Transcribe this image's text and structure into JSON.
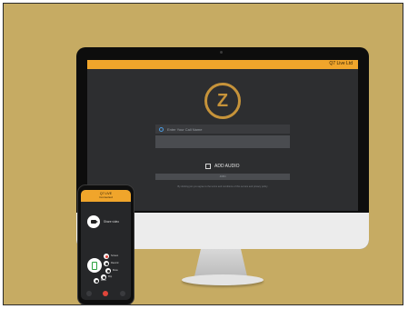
{
  "desktop": {
    "brand": "Q7 Live Ltd",
    "logo_letter": "Z",
    "name_label": "Enter Your Call Name",
    "name_input_placeholder": "",
    "audio_label": "ADD AUDIO",
    "join_label": "JOIN",
    "fine_print": "By clicking join you agree to the terms and conditions of this service and privacy policy"
  },
  "phone": {
    "title": "Q7 LIVE",
    "subtitle": "Connected",
    "camera_label": "Share video",
    "menu": [
      {
        "label": "Screen",
        "color": "#e0453a"
      },
      {
        "label": "Record",
        "color": "#2b2b2b"
      },
      {
        "label": "Mute",
        "color": "#2b2b2b"
      },
      {
        "label": "Flip",
        "color": "#2b2b2b"
      },
      {
        "label": "More",
        "color": "#2b2b2b"
      }
    ],
    "bar": [
      {
        "name": "mic",
        "color": "#3a3b3e"
      },
      {
        "name": "end-call",
        "color": "#e0453a"
      },
      {
        "name": "settings",
        "color": "#3a3b3e"
      }
    ]
  },
  "colors": {
    "background": "#c6ab63",
    "accent": "#f0a52b",
    "screen": "#2d2e30"
  }
}
